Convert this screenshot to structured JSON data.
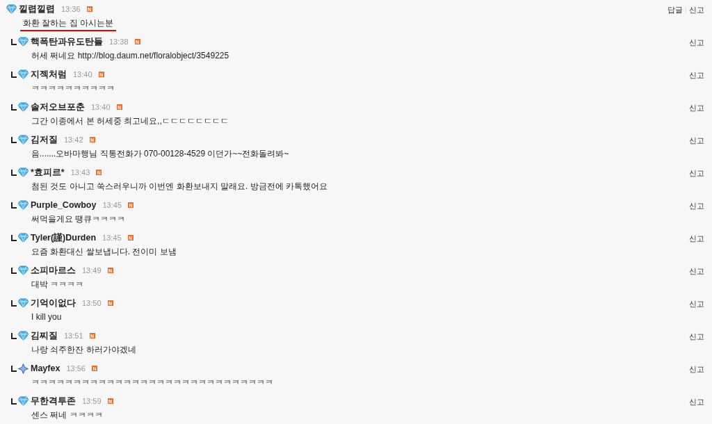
{
  "comment": {
    "name": "낄렵낄렵",
    "time": "13:36",
    "badge": "N",
    "kind": "diamond",
    "text": "화환 잘하는 집 아시는분",
    "actions": [
      "답글",
      "신고"
    ],
    "replies": [
      {
        "name": "핵폭탄과유도탄들",
        "time": "13:38",
        "badge": "N",
        "kind": "diamond",
        "text": "허세 쩌네요 http://blog.daum.net/floralobject/3549225",
        "actions": [
          "신고"
        ]
      },
      {
        "name": "지젝처럼",
        "time": "13:40",
        "badge": "N",
        "kind": "diamond",
        "text": "ㅋㅋㅋㅋㅋㅋㅋㅋㅋㅋ",
        "actions": [
          "신고"
        ]
      },
      {
        "name": "솔저오브포춘",
        "time": "13:40",
        "badge": "N",
        "kind": "diamond",
        "text": "그간 이종에서 본 허세중 최고네요,,ㄷㄷㄷㄷㄷㄷㄷㄷ",
        "actions": [
          "신고"
        ]
      },
      {
        "name": "김저질",
        "time": "13:42",
        "badge": "N",
        "kind": "diamond",
        "text": "음.......오바마행님 직통전화가 070-00128-4529 이던가~~전화돌려봐~",
        "actions": [
          "신고"
        ]
      },
      {
        "name": "*효피르*",
        "time": "13:43",
        "badge": "N",
        "kind": "diamond",
        "text": "첨된 것도 아니고 쑥스러우니까 이번엔 화환보내지 말래요. 방금전에 카톡했어요",
        "actions": [
          "신고"
        ]
      },
      {
        "name": "Purple_Cowboy",
        "time": "13:45",
        "badge": "N",
        "kind": "diamond",
        "text": "써먹을게요 땡큐ㅋㅋㅋㅋ",
        "actions": [
          "신고"
        ]
      },
      {
        "name": "Tyler(謹)Durden",
        "time": "13:45",
        "badge": "N",
        "kind": "diamond",
        "text": "요즘 화환대신 쌀보냅니다. 전이미 보냄",
        "actions": [
          "신고"
        ]
      },
      {
        "name": "소피마르스",
        "time": "13:49",
        "badge": "N",
        "kind": "diamond",
        "text": "대박 ㅋㅋㅋㅋ",
        "actions": [
          "신고"
        ]
      },
      {
        "name": "기억이없다",
        "time": "13:50",
        "badge": "N",
        "kind": "diamond",
        "text": "I kill you",
        "actions": [
          "신고"
        ]
      },
      {
        "name": "김찌질",
        "time": "13:51",
        "badge": "N",
        "kind": "diamond",
        "text": "나랑 쇠주한잔 하러가야겠네",
        "actions": [
          "신고"
        ]
      },
      {
        "name": "Mayfex",
        "time": "13:56",
        "badge": "N",
        "kind": "cross",
        "text": "ㅋㅋㅋㅋㅋㅋㅋㅋㅋㅋㅋㅋㅋㅋㅋㅋㅋㅋㅋㅋㅋㅋㅋㅋㅋㅋㅋㅋㅋ",
        "actions": [
          "신고"
        ]
      },
      {
        "name": "무한격투존",
        "time": "13:59",
        "badge": "N",
        "kind": "diamond",
        "text": "센스 쩌네 ㅋㅋㅋㅋ",
        "actions": [
          "신고"
        ]
      }
    ]
  }
}
